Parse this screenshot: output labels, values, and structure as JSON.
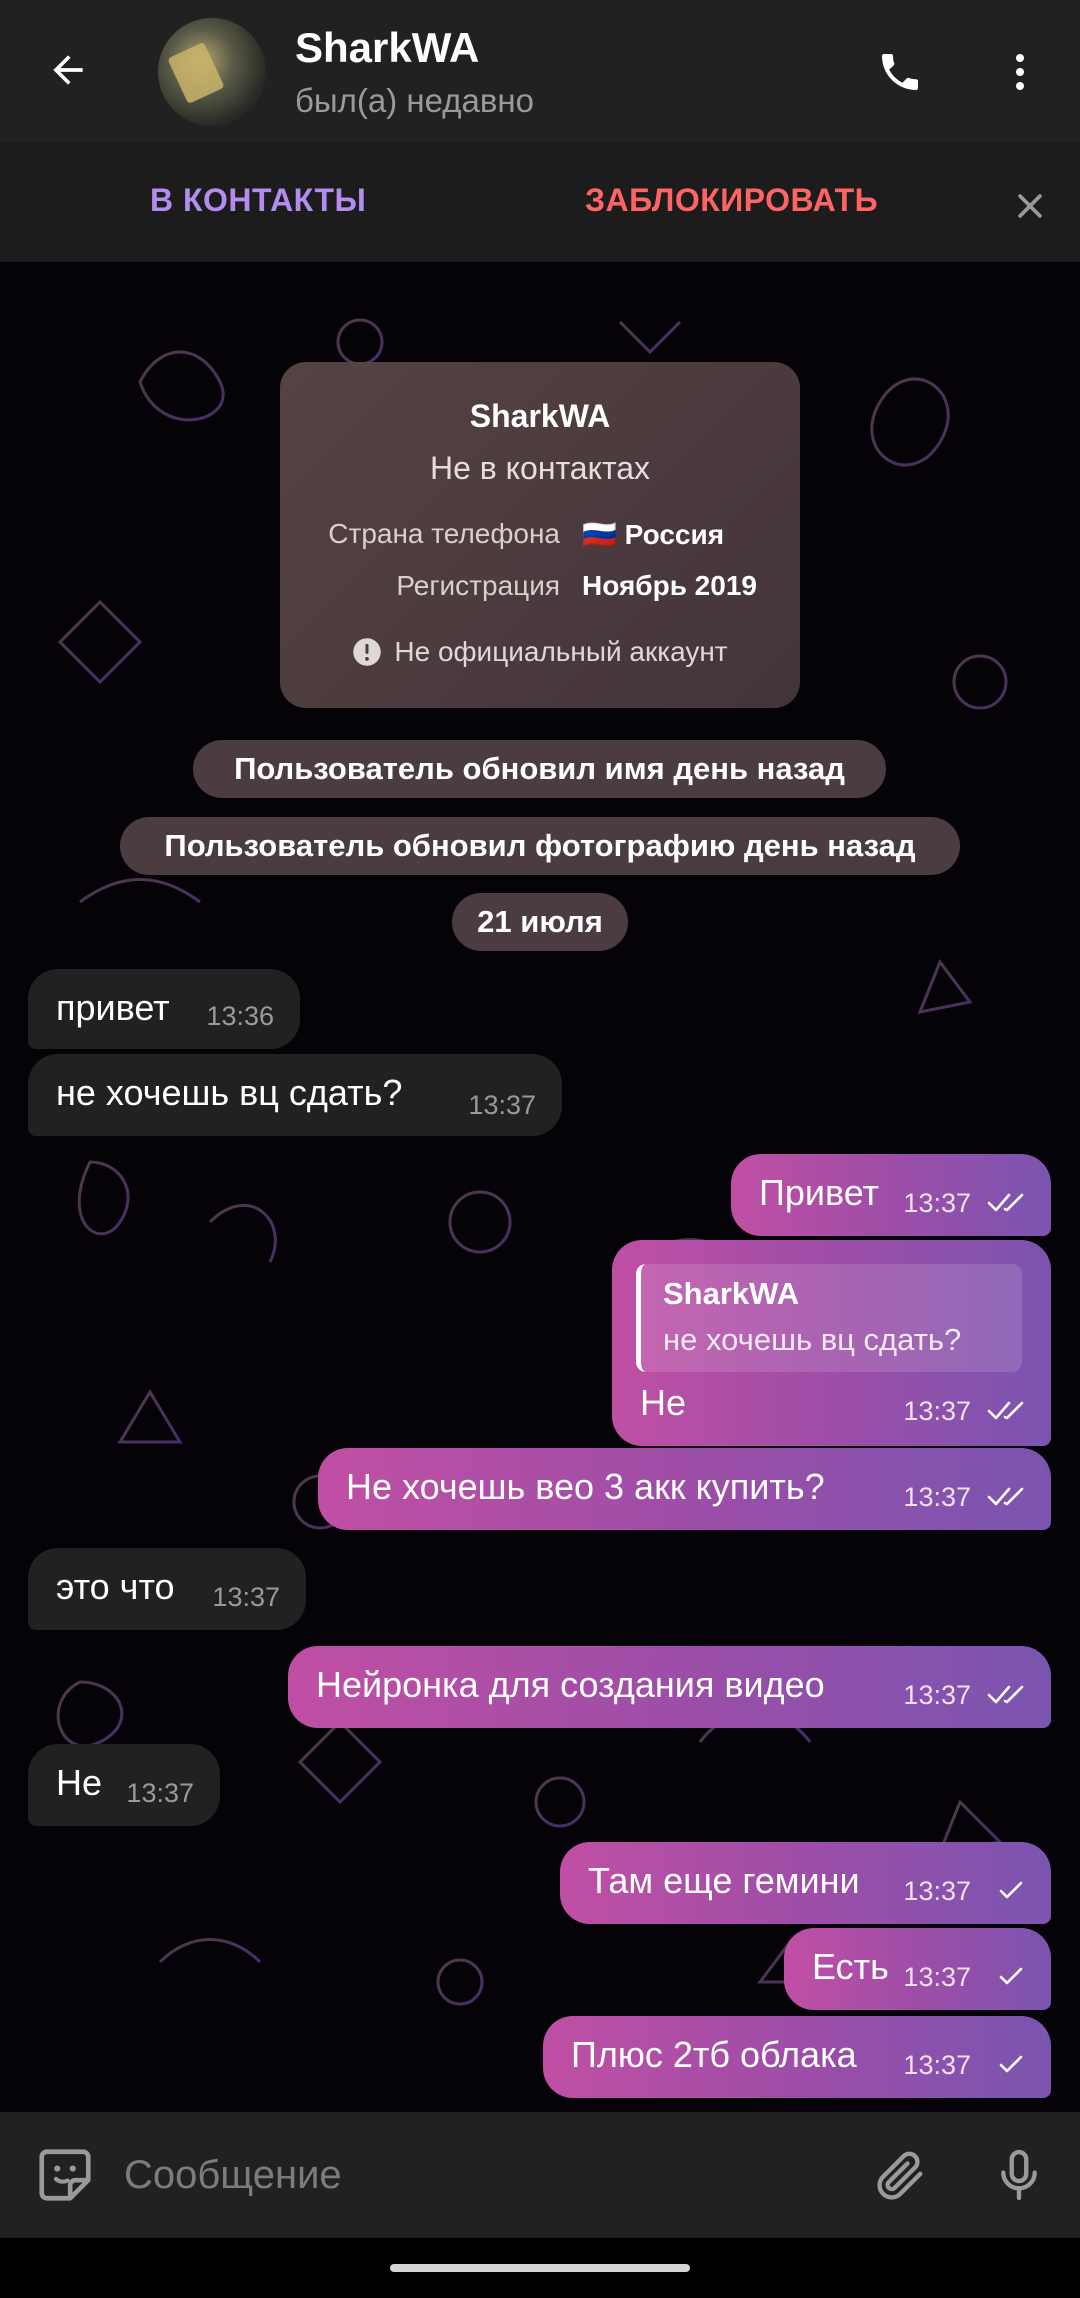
{
  "header": {
    "name": "SharkWA",
    "status": "был(а) недавно",
    "back_icon": "arrow-left-icon",
    "call_icon": "phone-icon",
    "menu_icon": "more-vertical-icon"
  },
  "action_bar": {
    "add_contact": "В КОНТАКТЫ",
    "block": "ЗАБЛОКИРОВАТЬ",
    "close_icon": "close-icon"
  },
  "info_card": {
    "name": "SharkWA",
    "subtitle": "Не в контактах",
    "rows": [
      {
        "label": "Страна телефона",
        "value": "🇷🇺 Россия"
      },
      {
        "label": "Регистрация",
        "value": "Ноябрь 2019"
      }
    ],
    "warning": "Не официальный аккаунт",
    "warning_icon": "exclamation-circle-icon"
  },
  "service_messages": [
    "Пользователь обновил имя день назад",
    "Пользователь обновил фотографию день назад",
    "21 июля"
  ],
  "messages": [
    {
      "direction": "in",
      "text": "привет",
      "time": "13:36"
    },
    {
      "direction": "in",
      "text": "не хочешь вц сдать?",
      "time": "13:37"
    },
    {
      "direction": "out",
      "text": "Привет",
      "time": "13:37",
      "status": "read"
    },
    {
      "direction": "out",
      "text": "Не",
      "time": "13:37",
      "status": "read",
      "reply": {
        "name": "SharkWA",
        "text": "не хочешь вц сдать?"
      }
    },
    {
      "direction": "out",
      "text": "Не хочешь вео 3 акк купить?",
      "time": "13:37",
      "status": "read"
    },
    {
      "direction": "in",
      "text": "это что",
      "time": "13:37"
    },
    {
      "direction": "out",
      "text": "Нейронка для создания видео",
      "time": "13:37",
      "status": "read"
    },
    {
      "direction": "in",
      "text": "Не",
      "time": "13:37"
    },
    {
      "direction": "out",
      "text": "Там еще гемини",
      "time": "13:37",
      "status": "sent"
    },
    {
      "direction": "out",
      "text": "Есть",
      "time": "13:37",
      "status": "sent"
    },
    {
      "direction": "out",
      "text": "Плюс 2тб облака",
      "time": "13:37",
      "status": "sent"
    }
  ],
  "composer": {
    "placeholder": "Сообщение",
    "sticker_icon": "sticker-icon",
    "attach_icon": "paperclip-icon",
    "mic_icon": "microphone-icon"
  },
  "colors": {
    "header_bg": "#212121",
    "accent_purple": "#b48cf0",
    "block_red": "#ff6464",
    "incoming_bubble": "#212121",
    "outgoing_gradient_start": "#c04fa4",
    "outgoing_gradient_end": "#7a55b0"
  }
}
